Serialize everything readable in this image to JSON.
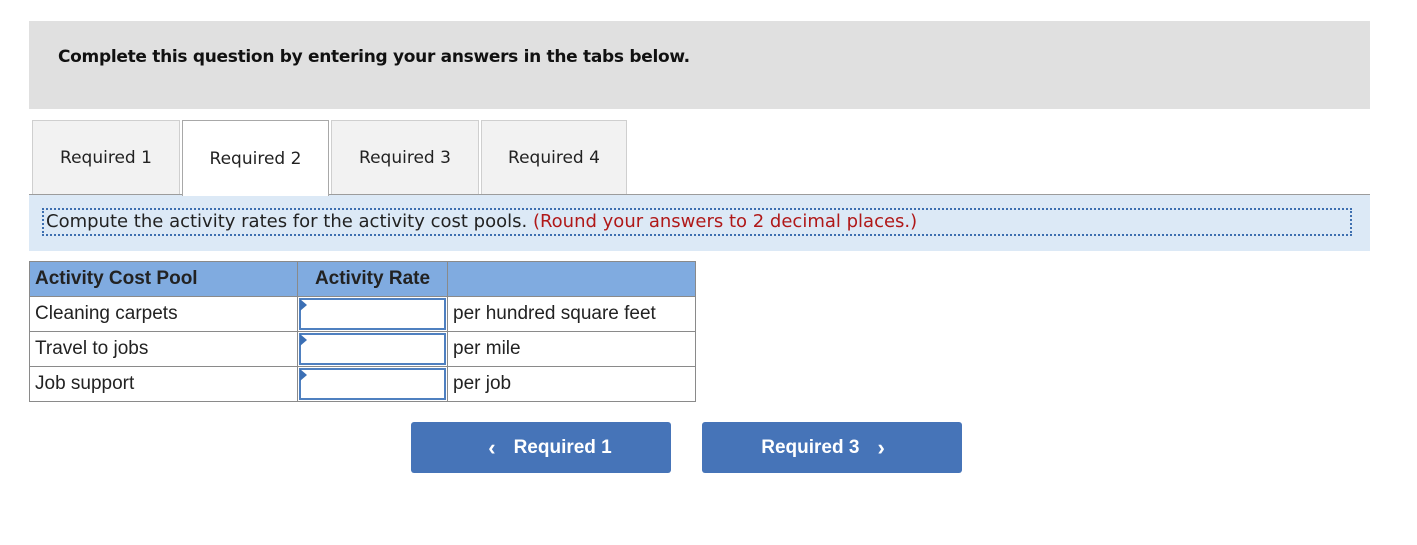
{
  "banner": {
    "text": "Complete this question by entering your answers in the tabs below."
  },
  "tabs": [
    {
      "label": "Required 1",
      "active": false
    },
    {
      "label": "Required 2",
      "active": true
    },
    {
      "label": "Required 3",
      "active": false
    },
    {
      "label": "Required 4",
      "active": false
    }
  ],
  "instruction": {
    "text": "Compute the activity rates for the activity cost pools.",
    "note": "(Round your answers to 2 decimal places.)"
  },
  "table": {
    "headers": [
      "Activity Cost Pool",
      "Activity Rate",
      ""
    ],
    "rows": [
      {
        "pool": "Cleaning carpets",
        "rate": "",
        "unit": "per hundred square feet"
      },
      {
        "pool": "Travel to jobs",
        "rate": "",
        "unit": "per mile"
      },
      {
        "pool": "Job support",
        "rate": "",
        "unit": "per job"
      }
    ]
  },
  "navigation": {
    "prev_label": "Required 1",
    "prev_icon": "chevron-left-icon",
    "prev_glyph": "‹",
    "next_label": "Required 3",
    "next_icon": "chevron-right-icon",
    "next_glyph": "›"
  },
  "colors": {
    "banner_bg": "#e0e0e0",
    "instruction_bg": "#dce9f6",
    "note_red": "#b01818",
    "header_blue": "#80abe0",
    "button_blue": "#4674b8"
  }
}
